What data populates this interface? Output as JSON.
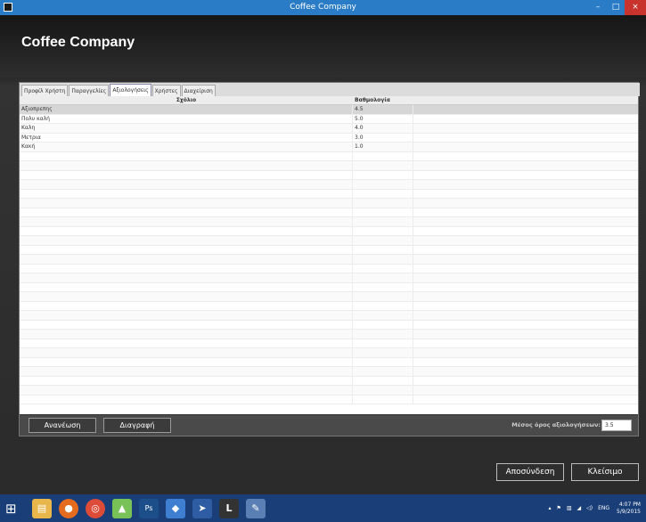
{
  "window": {
    "title": "Coffee Company",
    "minimize": "–",
    "maximize": "□",
    "close": "×"
  },
  "app": {
    "title": "Coffee Company"
  },
  "tabs": [
    {
      "label": "Προφίλ Χρήστη",
      "active": false
    },
    {
      "label": "Παραγγελίες",
      "active": false
    },
    {
      "label": "Αξιολογήσεις",
      "active": true
    },
    {
      "label": "Χρήστες",
      "active": false
    },
    {
      "label": "Διαχείριση",
      "active": false
    }
  ],
  "grid": {
    "columns": [
      "Σχόλιο",
      "Βαθμολογία"
    ],
    "rows": [
      {
        "comment": "Αξιοπρεπης",
        "rating": "4.5",
        "selected": true
      },
      {
        "comment": "Πολυ καλή",
        "rating": "5.0",
        "selected": false
      },
      {
        "comment": "Καλη",
        "rating": "4.0",
        "selected": false
      },
      {
        "comment": "Μετρια",
        "rating": "3.0",
        "selected": false
      },
      {
        "comment": "Κακή",
        "rating": "1.0",
        "selected": false
      }
    ]
  },
  "actions": {
    "refresh_label": "Ανανέωση",
    "delete_label": "Διαγραφή",
    "average_label": "Μέσος όρος αξιολογήσεων:",
    "average_value": "3.5"
  },
  "footer": {
    "logout_label": "Αποσύνδεση",
    "close_label": "Κλείσιμο"
  },
  "taskbar": {
    "language": "ENG",
    "time": "4:07 PM",
    "date": "5/9/2015",
    "apps": [
      "file-explorer-icon",
      "firefox-icon",
      "chrome-icon",
      "android-studio-icon",
      "photoshop-icon",
      "virtualbox-icon",
      "pointer-icon",
      "app-l-icon",
      "paint-icon"
    ]
  },
  "colors": {
    "titlebar": "#2a7cc6",
    "taskbar": "#1a3e78",
    "close": "#c9332e"
  }
}
